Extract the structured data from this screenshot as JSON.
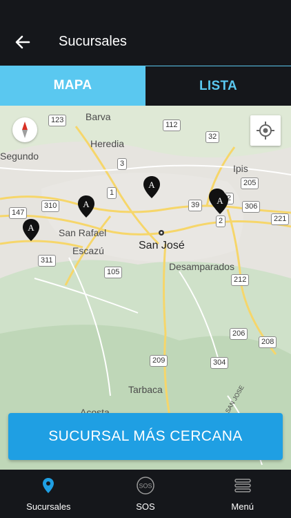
{
  "header": {
    "title": "Sucursales",
    "back_icon": "arrow-left-icon"
  },
  "tabs": [
    {
      "label": "MAPA",
      "active": true
    },
    {
      "label": "LISTA",
      "active": false
    }
  ],
  "map": {
    "places": {
      "barva": "Barva",
      "heredia": "Heredia",
      "segundo": "Segundo",
      "ipis": "Ipis",
      "san_rafael": "San Rafael",
      "escazu": "Escazú",
      "san_jose": "San José",
      "desamparados": "Desamparados",
      "tarbaca": "Tarbaca",
      "acosta": "Acosta",
      "road_label": "SAN JOSE"
    },
    "routes": {
      "r123": "123",
      "r112": "112",
      "r32": "32",
      "r3": "3",
      "r205": "205",
      "r1": "1",
      "r39": "39",
      "r2a": "2",
      "r306": "306",
      "r147": "147",
      "r310": "310",
      "r2b": "2",
      "r221": "221",
      "r311": "311",
      "r105": "105",
      "r212": "212",
      "r206": "206",
      "r208": "208",
      "r209": "209",
      "r304": "304"
    },
    "pin_letter": "A"
  },
  "cta": {
    "label": "SUCURSAL MÁS CERCANA"
  },
  "bottom_nav": [
    {
      "label": "Sucursales",
      "icon": "map-pin-icon",
      "color": "#1f9fe3"
    },
    {
      "label": "SOS",
      "icon": "sos-icon",
      "icon_text": "SOS"
    },
    {
      "label": "Menú",
      "icon": "menu-icon"
    }
  ]
}
